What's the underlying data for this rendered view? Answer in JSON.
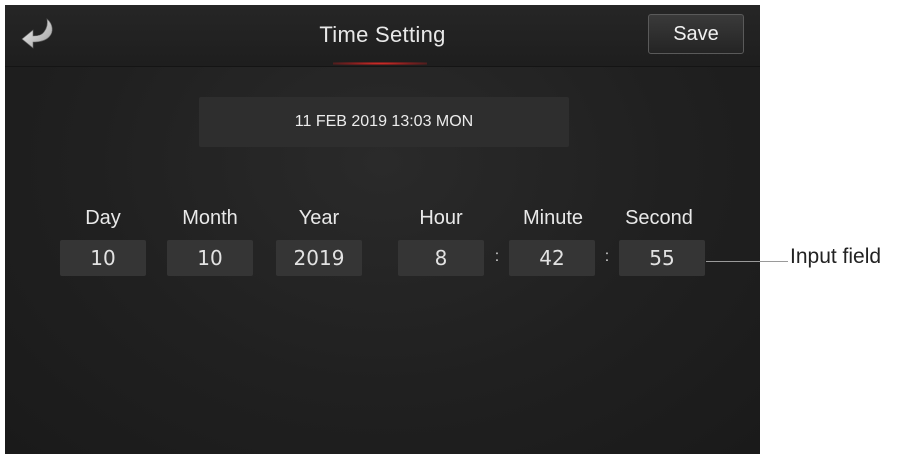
{
  "header": {
    "title": "Time Setting",
    "save_label": "Save",
    "back_icon": "back-arrow-icon"
  },
  "current_datetime": "11 FEB 2019 13:03 MON",
  "fields": {
    "day": {
      "label": "Day",
      "value": "10"
    },
    "month": {
      "label": "Month",
      "value": "10"
    },
    "year": {
      "label": "Year",
      "value": "2019"
    },
    "hour": {
      "label": "Hour",
      "value": "8"
    },
    "minute": {
      "label": "Minute",
      "value": "42"
    },
    "second": {
      "label": "Second",
      "value": "55"
    }
  },
  "time_separator": ":",
  "annotation": {
    "label": "Input field"
  },
  "colors": {
    "background": "#202020",
    "accent": "#e0302a",
    "input_bg": "#353535",
    "text": "#e8e8e8"
  }
}
